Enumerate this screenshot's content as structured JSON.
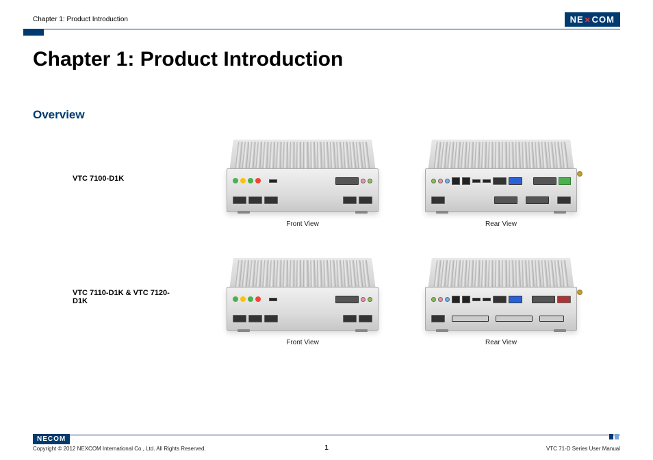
{
  "header": {
    "chapter_label": "Chapter 1: Product Introduction",
    "brand": "NEXCOM"
  },
  "title": "Chapter 1: Product Introduction",
  "section_heading": "Overview",
  "products": [
    {
      "name": "VTC 7100-D1K",
      "views": [
        {
          "caption": "Front View"
        },
        {
          "caption": "Rear View"
        }
      ]
    },
    {
      "name": "VTC 7110-D1K & VTC 7120-D1K",
      "views": [
        {
          "caption": "Front View"
        },
        {
          "caption": "Rear View"
        }
      ]
    }
  ],
  "footer": {
    "brand": "NEXCOM",
    "copyright": "Copyright © 2012 NEXCOM International Co., Ltd. All Rights Reserved.",
    "page_number": "1",
    "doc_title": "VTC 71-D Series User Manual"
  }
}
